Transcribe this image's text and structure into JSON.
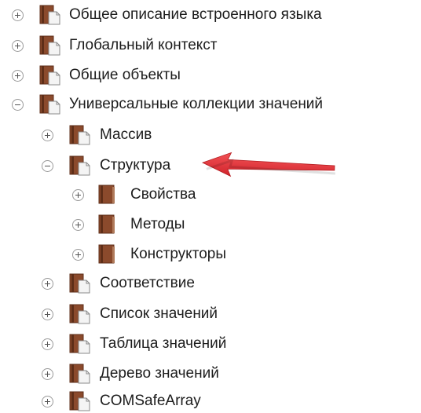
{
  "tree": {
    "items": [
      {
        "label": "Общее описание встроенного языка",
        "state": "collapsed",
        "icon": "book-page-icon"
      },
      {
        "label": "Глобальный контекст",
        "state": "collapsed",
        "icon": "book-page-icon"
      },
      {
        "label": "Общие объекты",
        "state": "collapsed",
        "icon": "book-page-icon"
      },
      {
        "label": "Универсальные коллекции значений",
        "state": "expanded",
        "icon": "book-page-icon"
      },
      {
        "label": "Массив",
        "state": "collapsed",
        "icon": "book-page-icon"
      },
      {
        "label": "Структура",
        "state": "expanded",
        "icon": "book-page-icon"
      },
      {
        "label": "Свойства",
        "state": "collapsed",
        "icon": "book-icon"
      },
      {
        "label": "Методы",
        "state": "collapsed",
        "icon": "book-icon"
      },
      {
        "label": "Конструкторы",
        "state": "collapsed",
        "icon": "book-icon"
      },
      {
        "label": "Соответствие",
        "state": "collapsed",
        "icon": "book-page-icon"
      },
      {
        "label": "Список значений",
        "state": "collapsed",
        "icon": "book-page-icon"
      },
      {
        "label": "Таблица значений",
        "state": "collapsed",
        "icon": "book-page-icon"
      },
      {
        "label": "Дерево значений",
        "state": "collapsed",
        "icon": "book-page-icon"
      },
      {
        "label": "COMSafeArray",
        "state": "collapsed",
        "icon": "book-page-icon"
      }
    ]
  },
  "annotation": {
    "arrow_icon": "red-arrow-icon",
    "color": "#e0242a"
  },
  "colors": {
    "book": "#8b4a2c",
    "book_dark": "#5e2e18",
    "page": "#f4f4f4"
  }
}
